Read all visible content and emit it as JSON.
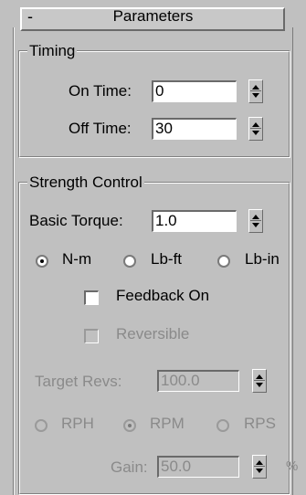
{
  "rollout": {
    "collapse_symbol": "-",
    "title": "Parameters"
  },
  "timing": {
    "title": "Timing",
    "on_time": {
      "label": "On Time:",
      "value": "0"
    },
    "off_time": {
      "label": "Off Time:",
      "value": "30"
    }
  },
  "strength": {
    "title": "Strength Control",
    "basic_torque": {
      "label": "Basic Torque:",
      "value": "1.0"
    },
    "units": [
      {
        "label": "N-m",
        "selected": true
      },
      {
        "label": "Lb-ft",
        "selected": false
      },
      {
        "label": "Lb-in",
        "selected": false
      }
    ],
    "feedback_on": {
      "label": "Feedback On",
      "checked": false
    },
    "reversible": {
      "label": "Reversible",
      "checked": false,
      "disabled": true
    },
    "target_revs": {
      "label": "Target Revs:",
      "value": "100.0",
      "disabled": true
    },
    "rev_units": [
      {
        "label": "RPH",
        "selected": false
      },
      {
        "label": "RPM",
        "selected": true
      },
      {
        "label": "RPS",
        "selected": false
      }
    ],
    "gain": {
      "label": "Gain:",
      "value": "50.0",
      "unit": "%",
      "disabled": true
    }
  },
  "icons": [
    "spinner-icon",
    "radio-icon",
    "checkbox-icon"
  ]
}
